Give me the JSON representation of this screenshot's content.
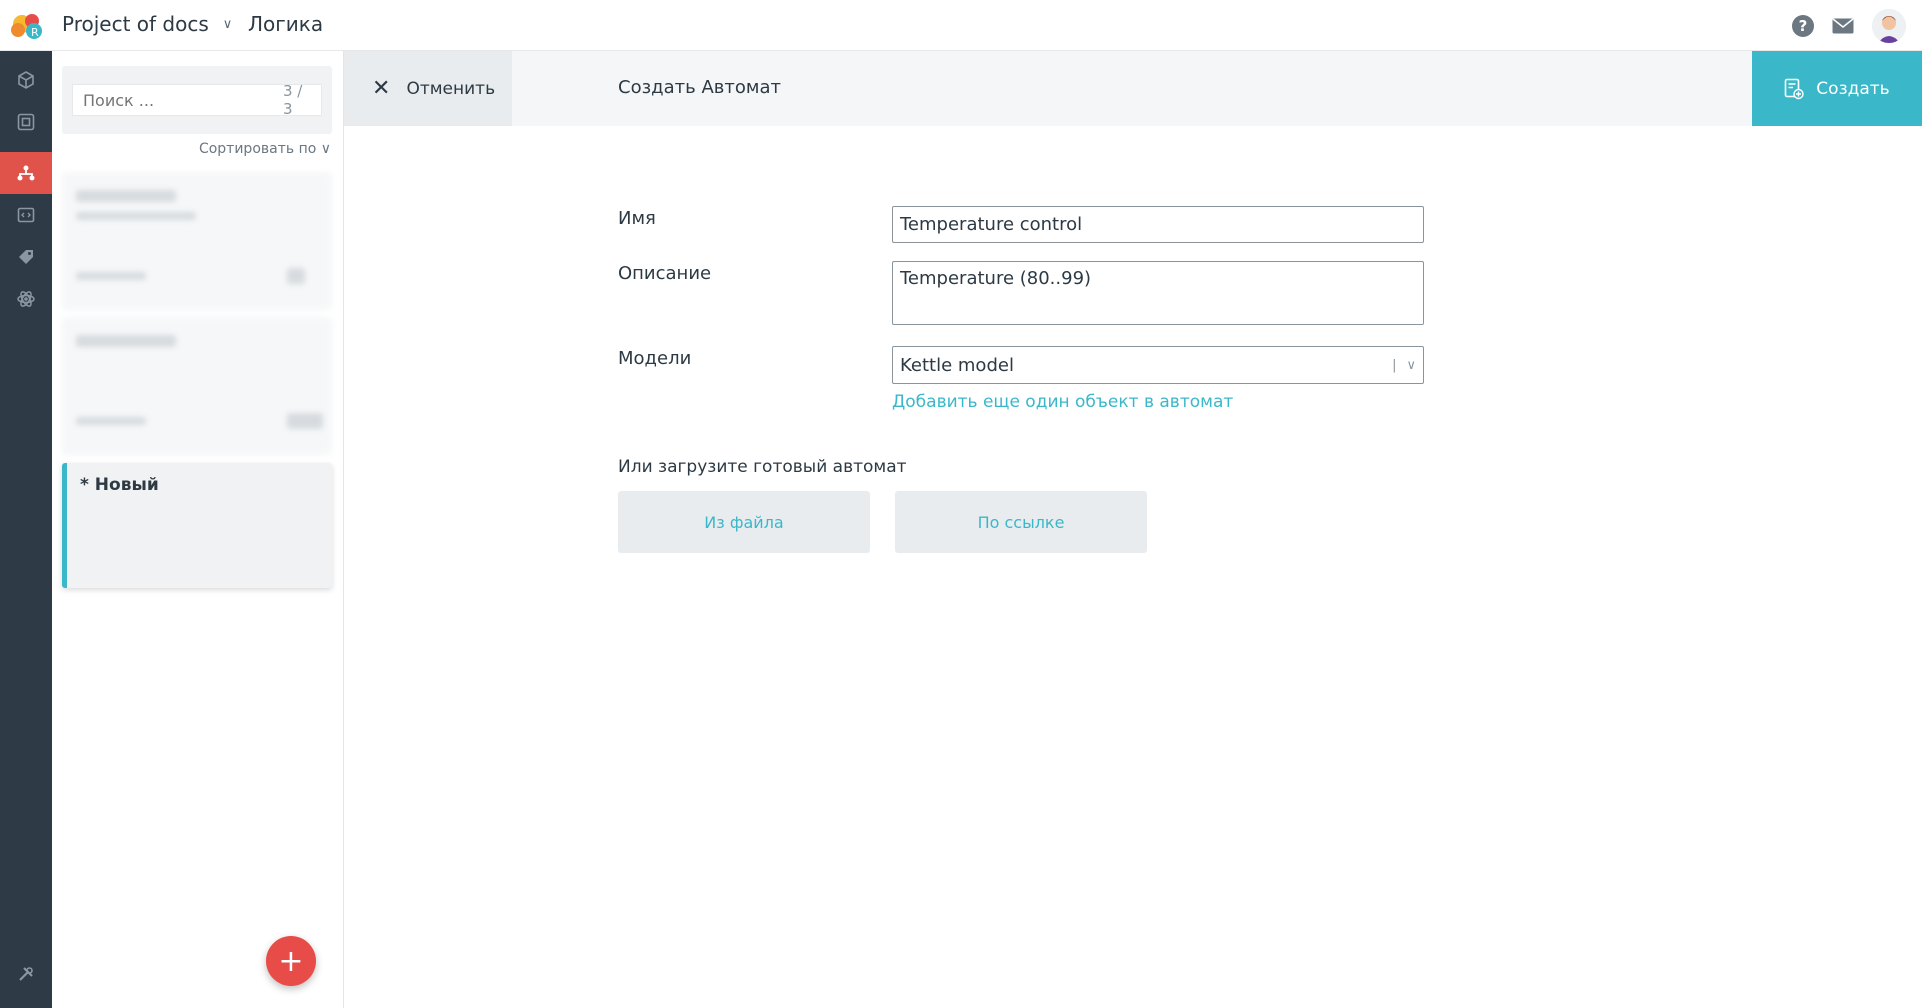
{
  "header": {
    "project_name": "Project of docs",
    "section": "Логика"
  },
  "sidebar_icons": [
    "cube-icon",
    "frame-icon",
    "hierarchy-icon",
    "code-window-icon",
    "tag-icon",
    "atom-icon",
    "tools-icon"
  ],
  "list": {
    "search_placeholder": "Поиск ...",
    "count": "3 / 3",
    "sort_label": "Сортировать по",
    "new_item_title": "* Новый"
  },
  "actionbar": {
    "cancel_label": "Отменить",
    "title": "Создать Автомат",
    "create_label": "Создать"
  },
  "form": {
    "name_label": "Имя",
    "name_value": "Temperature control",
    "description_label": "Описание",
    "description_value": "Temperature (80..99)",
    "models_label": "Модели",
    "models_value": "Kettle model",
    "add_object_link": "Добавить еще один объект в автомат",
    "upload_label": "Или загрузите готовый автомат",
    "from_file_label": "Из файла",
    "by_link_label": "По ссылке"
  },
  "colors": {
    "accent": "#3ab8c9",
    "rail_bg": "#2e3a45",
    "rail_active": "#e0534a",
    "fab": "#e74c48"
  }
}
